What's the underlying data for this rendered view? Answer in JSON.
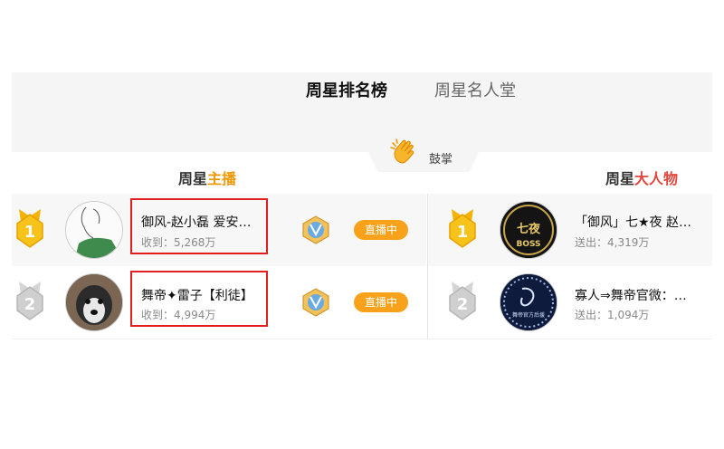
{
  "tabs": [
    {
      "label": "周星排名榜",
      "active": true
    },
    {
      "label": "周星名人堂",
      "active": false
    }
  ],
  "clap": {
    "label": "鼓掌",
    "icon": "clapping-hands-icon"
  },
  "sections": {
    "left": {
      "prefix": "周星",
      "highlight": "主播"
    },
    "right": {
      "prefix": "周星",
      "highlight": "大人物"
    }
  },
  "anchors": [
    {
      "rank": "1",
      "name": "御风-赵小磊 爱安…",
      "stat": "收到：5,268万",
      "live_label": "直播中"
    },
    {
      "rank": "2",
      "name": "舞帝✦雷子【利徒】",
      "stat": "收到：4,994万",
      "live_label": "直播中"
    }
  ],
  "vips": [
    {
      "rank": "1",
      "name": "「御风」七★夜 赵…",
      "stat": "送出：4,319万",
      "avatar_text": "七夜",
      "avatar_sub": "BOSS"
    },
    {
      "rank": "2",
      "name": "寡人⇒舞帝官微：…",
      "stat": "送出：1,094万",
      "avatar_text": "舞帝官方后援"
    }
  ],
  "colors": {
    "gold": "#f5b300",
    "silver": "#c4c4c4",
    "live": "#f7a21a",
    "highlight_orange": "#f39800",
    "highlight_red": "#e2453b",
    "annotation": "#e02020"
  }
}
